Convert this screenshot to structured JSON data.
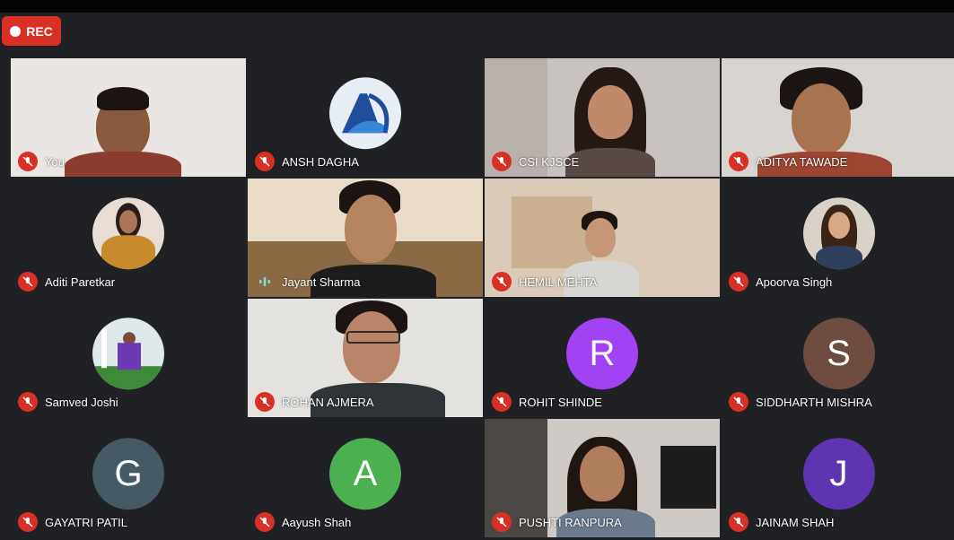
{
  "recording": {
    "label": "REC",
    "color": "#d93025"
  },
  "colors": {
    "mute_badge": "#d93025",
    "tile_bg": "#3c4043",
    "page_bg": "#202124"
  },
  "participants": [
    {
      "name": "You",
      "muted": true,
      "view": "video"
    },
    {
      "name": "ANSH DAGHA",
      "muted": true,
      "view": "logo-avatar"
    },
    {
      "name": "CSI KJSCE",
      "muted": true,
      "view": "video"
    },
    {
      "name": "ADITYA TAWADE",
      "muted": true,
      "view": "video"
    },
    {
      "name": "Aditi Paretkar",
      "muted": true,
      "view": "photo-avatar"
    },
    {
      "name": "Jayant Sharma",
      "muted": false,
      "speaking": true,
      "view": "video"
    },
    {
      "name": "HEMIL MEHTA",
      "muted": true,
      "view": "video"
    },
    {
      "name": "Apoorva Singh",
      "muted": true,
      "view": "photo-avatar"
    },
    {
      "name": "Samved Joshi",
      "muted": true,
      "view": "photo-avatar"
    },
    {
      "name": "ROHAN AJMERA",
      "muted": true,
      "view": "video"
    },
    {
      "name": "ROHIT SHINDE",
      "muted": true,
      "view": "letter-avatar",
      "initial": "R",
      "avatar_color": "#a142f4"
    },
    {
      "name": "SIDDHARTH MISHRA",
      "muted": true,
      "view": "letter-avatar",
      "initial": "S",
      "avatar_color": "#6d4c41"
    },
    {
      "name": "GAYATRI PATIL",
      "muted": true,
      "view": "letter-avatar",
      "initial": "G",
      "avatar_color": "#455a64"
    },
    {
      "name": "Aayush Shah",
      "muted": true,
      "view": "letter-avatar",
      "initial": "A",
      "avatar_color": "#4caf50"
    },
    {
      "name": "PUSHTI RANPURA",
      "muted": true,
      "view": "video"
    },
    {
      "name": "JAINAM SHAH",
      "muted": true,
      "view": "letter-avatar",
      "initial": "J",
      "avatar_color": "#5e35b1"
    }
  ],
  "icons": {
    "mute": "mic-off-icon",
    "speaking": "audio-level-icon",
    "record": "record-dot-icon"
  }
}
